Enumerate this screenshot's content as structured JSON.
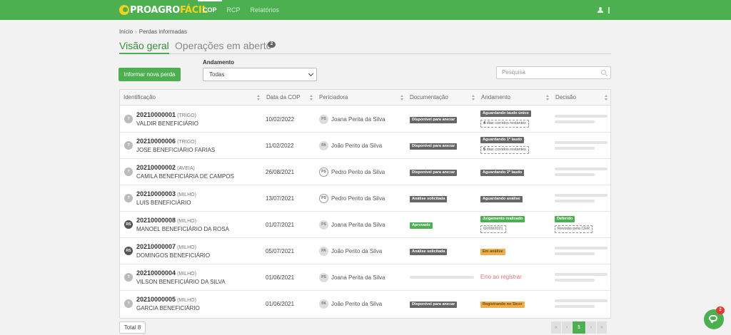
{
  "app": {
    "logo_part1": "PROAGRO",
    "logo_part2": "FÁCIL",
    "nav": [
      "COP",
      "RCP",
      "Relatórios"
    ],
    "active_nav": "COP"
  },
  "breadcrumb": {
    "home": "Início",
    "current": "Perdas informadas"
  },
  "tabs": {
    "overview": "Visão geral",
    "open_operations": "Operações em aberto",
    "open_operations_count": "2"
  },
  "toolbar": {
    "new_loss_button": "Informar nova perda",
    "status_filter_label": "Andamento",
    "status_filter_value": "Todas",
    "search_placeholder": "Pesquisa"
  },
  "table": {
    "columns": [
      "Identificação",
      "Data da COP",
      "Periciadora",
      "Documentação",
      "Andamento",
      "Decisão"
    ],
    "rows": [
      {
        "avatar": "?",
        "id": "20210000001",
        "crop": "(TRIGO)",
        "beneficiary": "VALDIR BENEFICIÁRIO",
        "date": "10/02/2022",
        "perit_initials": "PS",
        "perit": "Joana Perita da Silva",
        "doc": "Disponível para anexar",
        "status": "Aguardando laudo único",
        "status_note_number": "4",
        "status_note": "dias corridos restantes"
      },
      {
        "avatar": "?",
        "id": "20210000006",
        "crop": "(TRIGO)",
        "beneficiary": "JOSE BENEFICIÁRIO FARIAS",
        "date": "11/02/2022",
        "perit_initials": "PA",
        "perit": "João Perito da Silva",
        "doc": "Disponível para anexar",
        "status": "Aguardando 1º laudo",
        "status_note_number": "5",
        "status_note": "dias corridos restantes"
      },
      {
        "avatar": "?",
        "id": "20210000002",
        "crop": "(AVEIA)",
        "beneficiary": "CAMILA BENEFICIÁRIA DE CAMPOS",
        "date": "26/08/2021",
        "perit_initials": "PS",
        "perit": "Pedro Perito da Silva",
        "doc": "Disponível para anexar",
        "status": "Aguardando 2º laudo"
      },
      {
        "avatar": "?",
        "id": "20210000003",
        "crop": "(MILHO)",
        "beneficiary": "LUIS BENEFICIÁRIO",
        "date": "13/07/2021",
        "perit_initials": "PS",
        "perit": "Pedro Perito da Silva",
        "doc": "Análise solicitada",
        "status": "Aguardando análise"
      },
      {
        "avatar": "RS",
        "id": "20210000008",
        "crop": "(MILHO)",
        "beneficiary": "MANOEL BENEFICIÁRIO DA ROSA",
        "date": "01/07/2021",
        "perit_initials": "PS",
        "perit": "Joana Perita da Silva",
        "doc": "Aprovado",
        "status": "Julgamento realizado",
        "status_note": "02/09/2021",
        "decision": "Deferido",
        "decision_note": "Revisão pela CER"
      },
      {
        "avatar": "RS",
        "id": "20210000007",
        "crop": "(MILHO)",
        "beneficiary": "DOMINGOS BENEFICIÁRIO",
        "date": "05/07/2021",
        "perit_initials": "PA",
        "perit": "João Perito da Silva",
        "doc": "Análise solicitada",
        "status": "Em análise"
      },
      {
        "avatar": "?",
        "id": "20210000004",
        "crop": "(MILHO)",
        "beneficiary": "VILSON BENEFICIÁRIO DA SILVA",
        "date": "01/06/2021",
        "perit_initials": "PS",
        "perit": "Joana Perita da Silva",
        "status": "Erro ao registrar"
      },
      {
        "avatar": "?",
        "id": "20210000005",
        "crop": "(MILHO)",
        "beneficiary": "GARCIA BENEFICIÁRIO",
        "date": "01/06/2021",
        "perit_initials": "PA",
        "perit": "João Perito da Silva",
        "doc": "Disponível para anexar",
        "status": "Registrando no Sicor"
      }
    ]
  },
  "footer": {
    "total": "Total 8",
    "pager": {
      "first": "«",
      "prev": "‹",
      "page": "1",
      "next": "›",
      "last": "»"
    }
  },
  "chat": {
    "unread": "2"
  },
  "colors": {
    "brand": "#4caf50",
    "logo_accent": "#f5d31b",
    "error": "#e57373"
  }
}
